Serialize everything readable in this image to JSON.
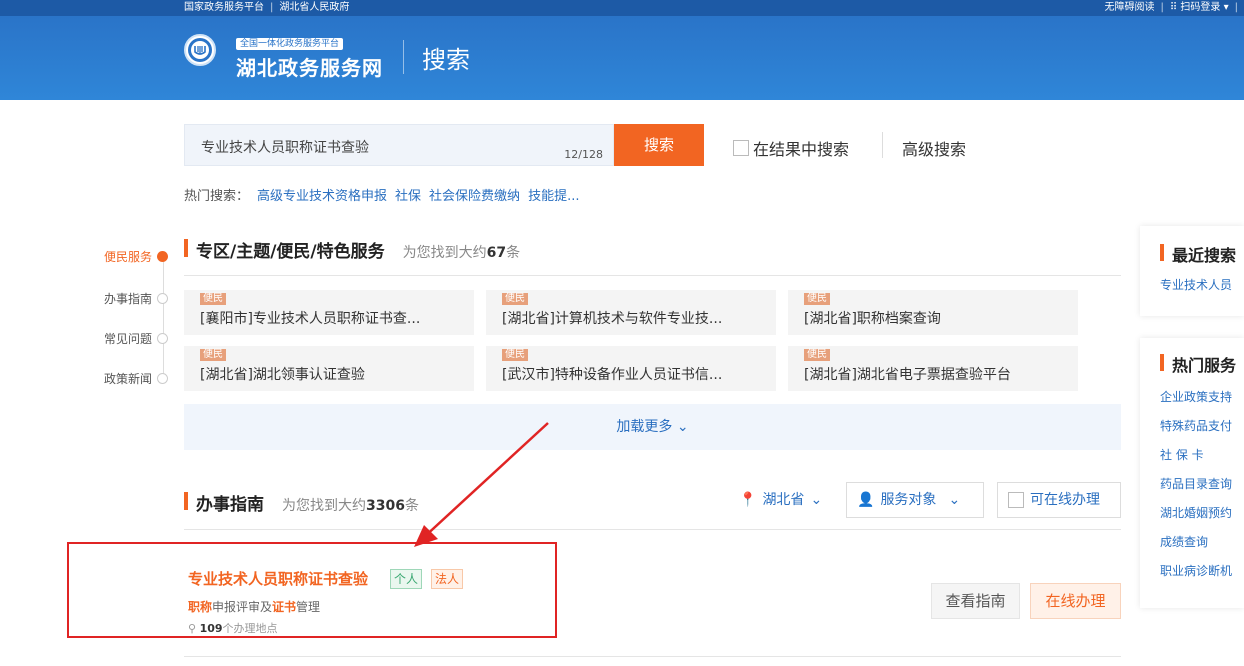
{
  "topbar": {
    "links_left": [
      "国家政务服务平台",
      "湖北省人民政府"
    ],
    "accessibility": "无障碍阅读",
    "qr_login": "扫码登录"
  },
  "header": {
    "tag": "全国一体化政务服务平台",
    "title": "湖北政务服务网",
    "page": "搜索"
  },
  "search": {
    "value": "专业技术人员职称证书查验",
    "count": "12/128",
    "button": "搜索",
    "in_result": "在结果中搜索",
    "advanced": "高级搜索"
  },
  "hot": {
    "label": "热门搜索：",
    "items": [
      "高级专业技术资格申报",
      "社保",
      "社会保险费缴纳",
      "技能提..."
    ]
  },
  "sidenav": [
    "便民服务",
    "办事指南",
    "常见问题",
    "政策新闻"
  ],
  "section1": {
    "title": "专区/主题/便民/特色服务",
    "found_prefix": "为您找到大约",
    "count": "67",
    "found_suffix": "条",
    "badge": "便民",
    "cards": [
      "[襄阳市]专业技术人员职称证书查...",
      "[湖北省]计算机技术与软件专业技...",
      "[湖北省]职称档案查询",
      "[湖北省]湖北领事认证查验",
      "[武汉市]特种设备作业人员证书信...",
      "[湖北省]湖北省电子票据查验平台"
    ],
    "load_more": "加载更多 ⌄"
  },
  "section2": {
    "title": "办事指南",
    "found_prefix": "为您找到大约",
    "count": "3306",
    "found_suffix": "条",
    "filter_region": "湖北省",
    "filter_target": "服务对象",
    "filter_online": "可在线办理"
  },
  "result": {
    "title": "专业技术人员职称证书查验",
    "tag_person": "个人",
    "tag_legal": "法人",
    "desc_hl1": "职称",
    "desc_mid": "申报评审及",
    "desc_hl2": "证书",
    "desc_end": "管理",
    "sites_count": "109",
    "sites_suffix": "个办理地点",
    "btn_guide": "查看指南",
    "btn_online": "在线办理"
  },
  "recent": {
    "title": "最近搜索",
    "items": [
      "专业技术人员"
    ]
  },
  "hot_services": {
    "title": "热门服务",
    "items": [
      "企业政策支持",
      "特殊药品支付",
      "社 保 卡",
      "药品目录查询",
      "湖北婚姻预约",
      "成绩查询",
      "职业病诊断机"
    ]
  },
  "colors": {
    "primary": "#2a74c8",
    "accent": "#f26522",
    "highlight_box": "#e02424"
  }
}
